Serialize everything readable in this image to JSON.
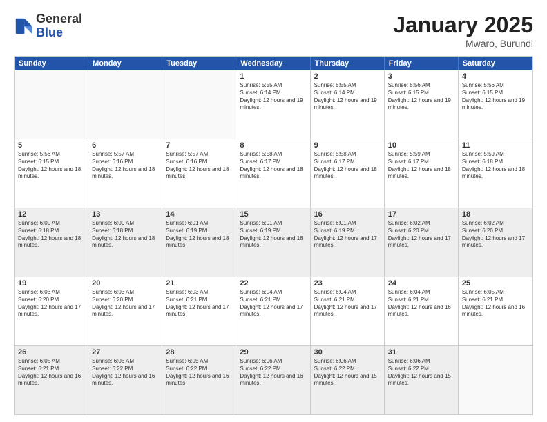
{
  "header": {
    "logo": {
      "general": "General",
      "blue": "Blue"
    },
    "title": "January 2025",
    "location": "Mwaro, Burundi"
  },
  "weekdays": [
    "Sunday",
    "Monday",
    "Tuesday",
    "Wednesday",
    "Thursday",
    "Friday",
    "Saturday"
  ],
  "rows": [
    [
      {
        "day": "",
        "text": "",
        "empty": true
      },
      {
        "day": "",
        "text": "",
        "empty": true
      },
      {
        "day": "",
        "text": "",
        "empty": true
      },
      {
        "day": "1",
        "text": "Sunrise: 5:55 AM\nSunset: 6:14 PM\nDaylight: 12 hours and 19 minutes."
      },
      {
        "day": "2",
        "text": "Sunrise: 5:55 AM\nSunset: 6:14 PM\nDaylight: 12 hours and 19 minutes."
      },
      {
        "day": "3",
        "text": "Sunrise: 5:56 AM\nSunset: 6:15 PM\nDaylight: 12 hours and 19 minutes."
      },
      {
        "day": "4",
        "text": "Sunrise: 5:56 AM\nSunset: 6:15 PM\nDaylight: 12 hours and 19 minutes."
      }
    ],
    [
      {
        "day": "5",
        "text": "Sunrise: 5:56 AM\nSunset: 6:15 PM\nDaylight: 12 hours and 18 minutes."
      },
      {
        "day": "6",
        "text": "Sunrise: 5:57 AM\nSunset: 6:16 PM\nDaylight: 12 hours and 18 minutes."
      },
      {
        "day": "7",
        "text": "Sunrise: 5:57 AM\nSunset: 6:16 PM\nDaylight: 12 hours and 18 minutes."
      },
      {
        "day": "8",
        "text": "Sunrise: 5:58 AM\nSunset: 6:17 PM\nDaylight: 12 hours and 18 minutes."
      },
      {
        "day": "9",
        "text": "Sunrise: 5:58 AM\nSunset: 6:17 PM\nDaylight: 12 hours and 18 minutes."
      },
      {
        "day": "10",
        "text": "Sunrise: 5:59 AM\nSunset: 6:17 PM\nDaylight: 12 hours and 18 minutes."
      },
      {
        "day": "11",
        "text": "Sunrise: 5:59 AM\nSunset: 6:18 PM\nDaylight: 12 hours and 18 minutes."
      }
    ],
    [
      {
        "day": "12",
        "text": "Sunrise: 6:00 AM\nSunset: 6:18 PM\nDaylight: 12 hours and 18 minutes."
      },
      {
        "day": "13",
        "text": "Sunrise: 6:00 AM\nSunset: 6:18 PM\nDaylight: 12 hours and 18 minutes."
      },
      {
        "day": "14",
        "text": "Sunrise: 6:01 AM\nSunset: 6:19 PM\nDaylight: 12 hours and 18 minutes."
      },
      {
        "day": "15",
        "text": "Sunrise: 6:01 AM\nSunset: 6:19 PM\nDaylight: 12 hours and 18 minutes."
      },
      {
        "day": "16",
        "text": "Sunrise: 6:01 AM\nSunset: 6:19 PM\nDaylight: 12 hours and 17 minutes."
      },
      {
        "day": "17",
        "text": "Sunrise: 6:02 AM\nSunset: 6:20 PM\nDaylight: 12 hours and 17 minutes."
      },
      {
        "day": "18",
        "text": "Sunrise: 6:02 AM\nSunset: 6:20 PM\nDaylight: 12 hours and 17 minutes."
      }
    ],
    [
      {
        "day": "19",
        "text": "Sunrise: 6:03 AM\nSunset: 6:20 PM\nDaylight: 12 hours and 17 minutes."
      },
      {
        "day": "20",
        "text": "Sunrise: 6:03 AM\nSunset: 6:20 PM\nDaylight: 12 hours and 17 minutes."
      },
      {
        "day": "21",
        "text": "Sunrise: 6:03 AM\nSunset: 6:21 PM\nDaylight: 12 hours and 17 minutes."
      },
      {
        "day": "22",
        "text": "Sunrise: 6:04 AM\nSunset: 6:21 PM\nDaylight: 12 hours and 17 minutes."
      },
      {
        "day": "23",
        "text": "Sunrise: 6:04 AM\nSunset: 6:21 PM\nDaylight: 12 hours and 17 minutes."
      },
      {
        "day": "24",
        "text": "Sunrise: 6:04 AM\nSunset: 6:21 PM\nDaylight: 12 hours and 16 minutes."
      },
      {
        "day": "25",
        "text": "Sunrise: 6:05 AM\nSunset: 6:21 PM\nDaylight: 12 hours and 16 minutes."
      }
    ],
    [
      {
        "day": "26",
        "text": "Sunrise: 6:05 AM\nSunset: 6:21 PM\nDaylight: 12 hours and 16 minutes."
      },
      {
        "day": "27",
        "text": "Sunrise: 6:05 AM\nSunset: 6:22 PM\nDaylight: 12 hours and 16 minutes."
      },
      {
        "day": "28",
        "text": "Sunrise: 6:05 AM\nSunset: 6:22 PM\nDaylight: 12 hours and 16 minutes."
      },
      {
        "day": "29",
        "text": "Sunrise: 6:06 AM\nSunset: 6:22 PM\nDaylight: 12 hours and 16 minutes."
      },
      {
        "day": "30",
        "text": "Sunrise: 6:06 AM\nSunset: 6:22 PM\nDaylight: 12 hours and 15 minutes."
      },
      {
        "day": "31",
        "text": "Sunrise: 6:06 AM\nSunset: 6:22 PM\nDaylight: 12 hours and 15 minutes."
      },
      {
        "day": "",
        "text": "",
        "empty": true
      }
    ]
  ]
}
